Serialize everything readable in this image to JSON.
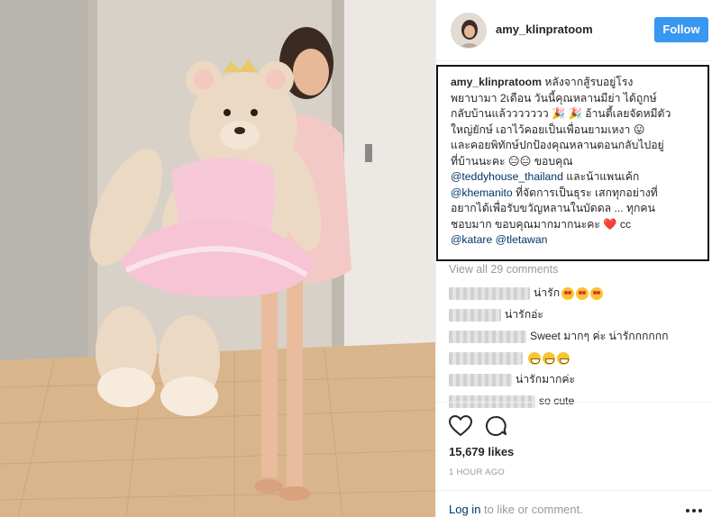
{
  "post": {
    "username": "amy_klinpratoom",
    "follow_label": "Follow",
    "caption": {
      "user": "amy_klinpratoom",
      "line1": "หลังจากสู้รบอยู่โรง",
      "line2": "พยาบามา 2เดือน วันนี้คุณหลานมีย่า ได้ถูกษ์",
      "line3": "กลับบ้านแล้ววววววว 🎉 🎉 อ้านตี้เลยจัดหมีตัว",
      "line4": "ใหญ่ยักษ์ เอาไว้คอยเป็นเพื่อนยามเหงา 😛",
      "line5": "และคอยพิทักษ์ปกป้องคุณหลานตอนกลับไปอยู่",
      "line6": "ที่บ้านนะคะ 😑😑 ขอบคุณ",
      "mention1": "@teddyhouse_thailand",
      "line7": " และน้าแพนเค้ก",
      "mention2": "@khemanito",
      "line8": " ที่จัดการเป็นธุระ เสกทุกอย่างที่",
      "line9": "อยากได้เพื่อรับขวัญหลานในบัดดล ... ทุกคน",
      "line10": "ชอบมาก ขอบคุณมากมากนะคะ ❤️ cc",
      "mention3": "@katare",
      "mention4": "@tletawan"
    },
    "view_all": "View all 29 comments",
    "comments": [
      {
        "text": "น่ารัก"
      },
      {
        "text": "น่ารักอ่ะ"
      },
      {
        "text": "Sweet มากๆ ค่ะ น่ารักกกกกก"
      },
      {
        "text": ""
      },
      {
        "text": "น่ารักมากค่ะ"
      },
      {
        "text": "so cute"
      }
    ],
    "likes": "15,679 likes",
    "time": "1 HOUR AGO",
    "footer": {
      "login": "Log in",
      "rest": " to like or comment."
    }
  },
  "icons": {
    "like": "heart-outline-icon",
    "comment": "speech-bubble-icon",
    "more": "ellipsis-icon"
  },
  "colors": {
    "follow_button": "#3897f0",
    "link": "#003569",
    "muted": "#999999"
  }
}
